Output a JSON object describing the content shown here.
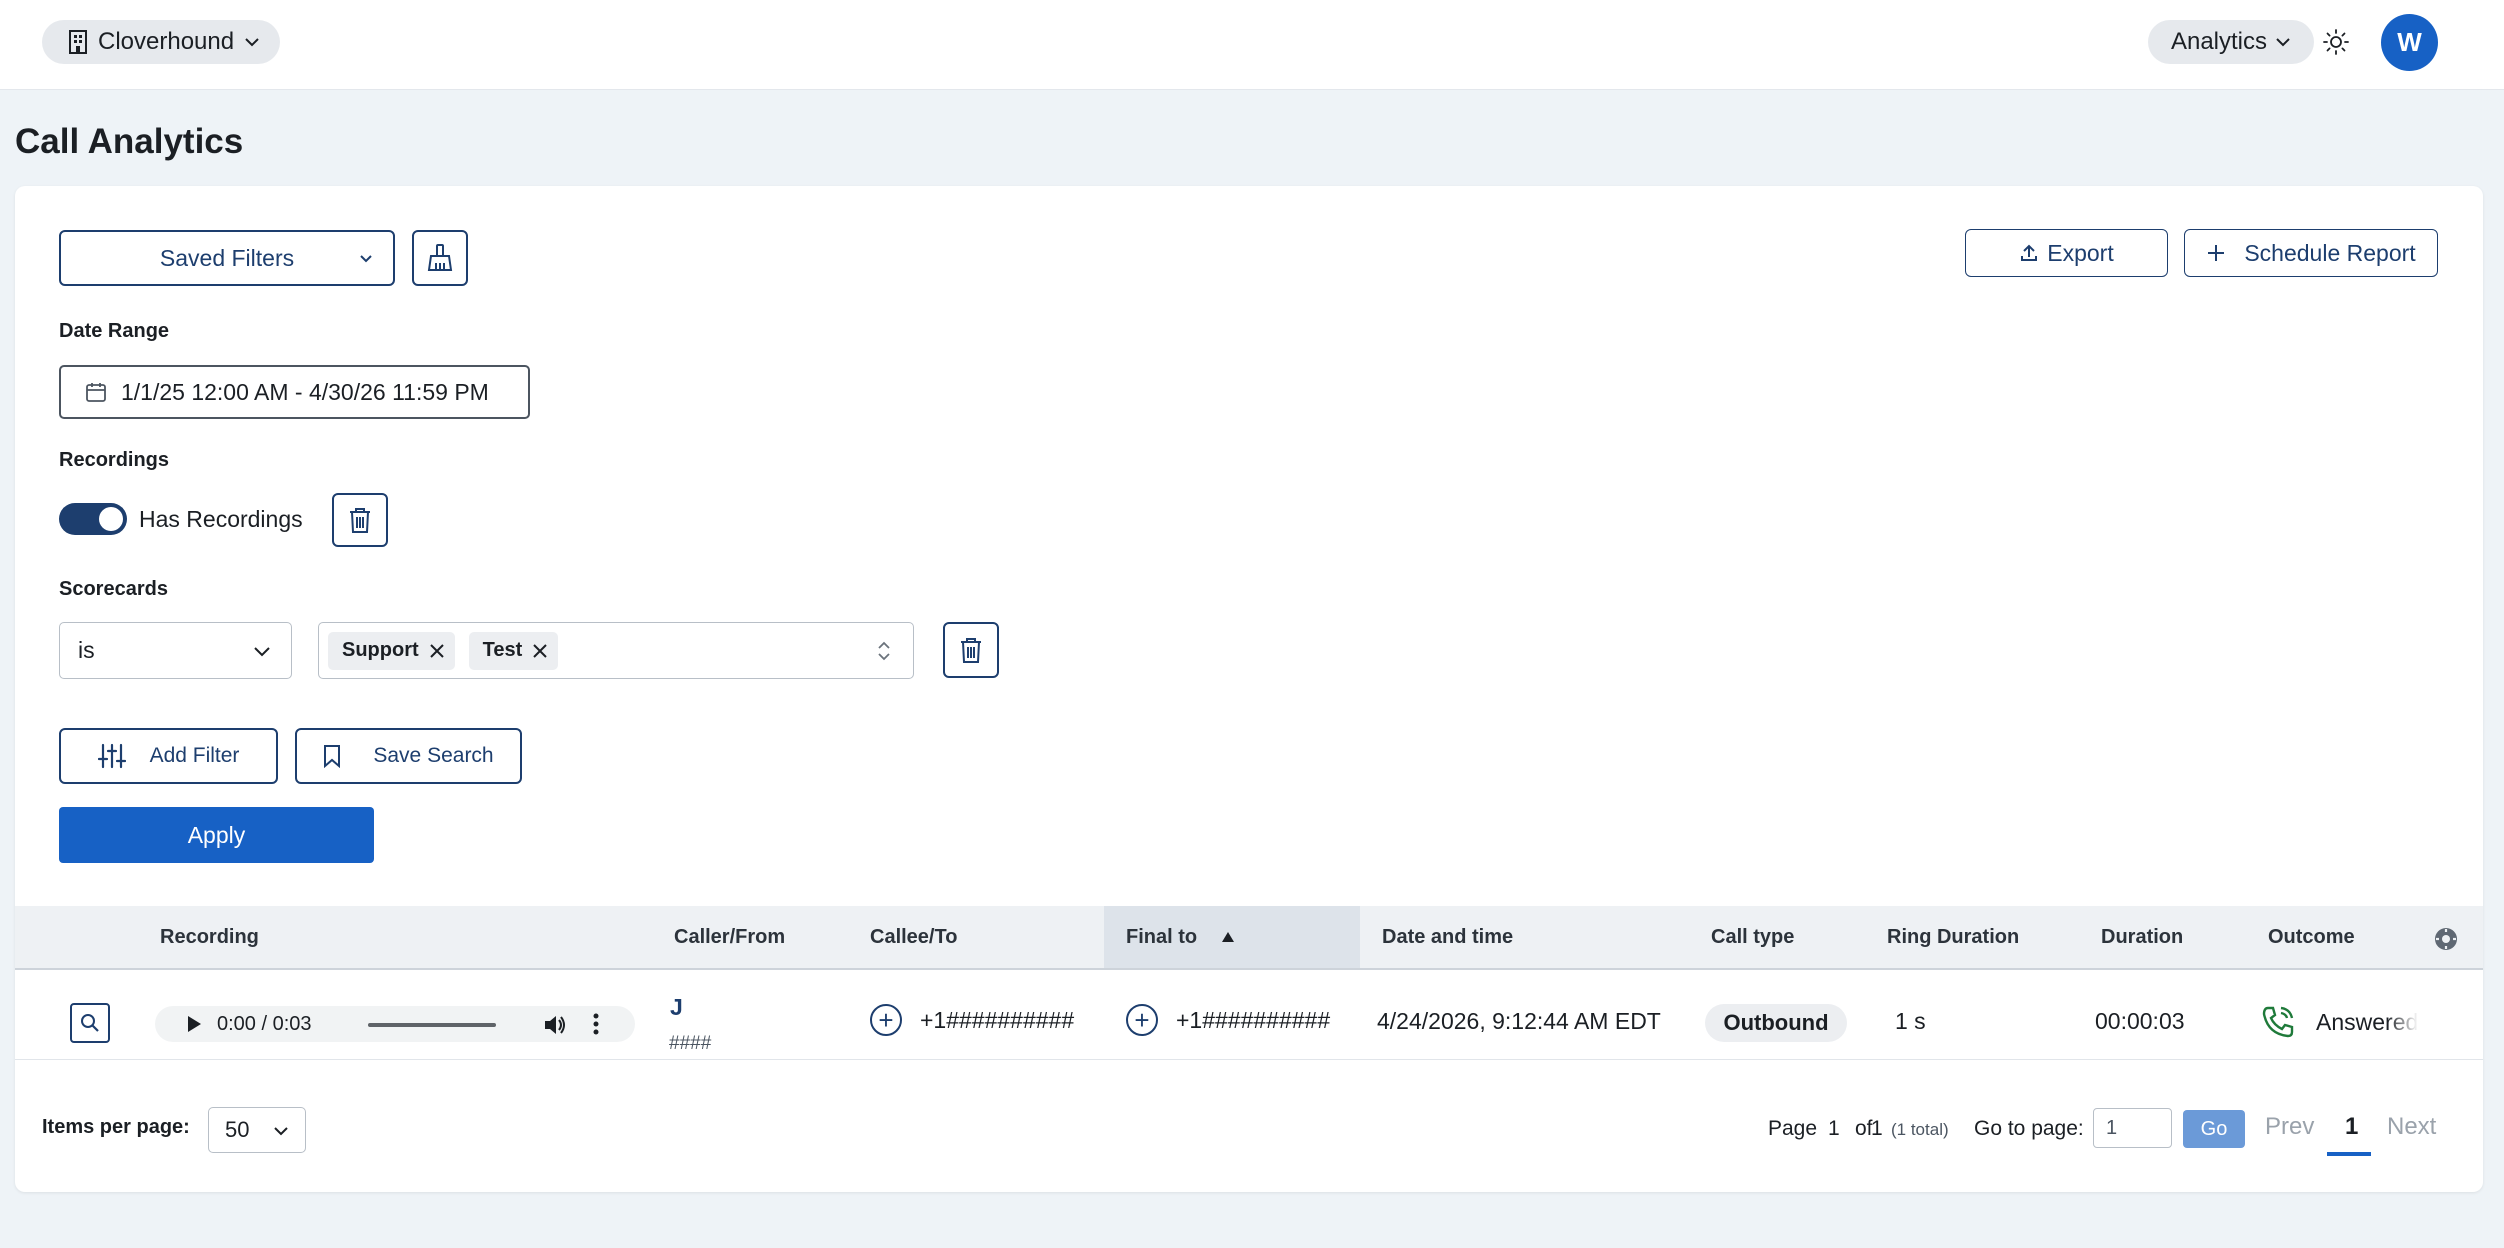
{
  "header": {
    "org_name": "Cloverhound",
    "analytics_label": "Analytics",
    "avatar_initial": "W"
  },
  "page": {
    "title": "Call Analytics"
  },
  "filters": {
    "saved_filters_label": "Saved Filters",
    "export_label": "Export",
    "schedule_report_label": "Schedule Report",
    "date_range_label": "Date Range",
    "date_range_value": "1/1/25 12:00 AM - 4/30/26 11:59 PM",
    "recordings_label": "Recordings",
    "has_recordings_label": "Has Recordings",
    "has_recordings_on": true,
    "scorecards_label": "Scorecards",
    "scorecards_operator": "is",
    "scorecards_chips": [
      "Support",
      "Test"
    ],
    "add_filter_label": "Add Filter",
    "save_search_label": "Save Search",
    "apply_label": "Apply"
  },
  "table": {
    "columns": [
      "Recording",
      "Caller/From",
      "Callee/To",
      "Final to",
      "Date and time",
      "Call type",
      "Ring Duration",
      "Duration",
      "Outcome"
    ],
    "sorted_column": "Final to",
    "rows": [
      {
        "player_time": "0:00 / 0:03",
        "caller_name": "J",
        "caller_number": "####",
        "callee": "+1##########",
        "final_to": "+1##########",
        "datetime": "4/24/2026, 9:12:44 AM EDT",
        "call_type": "Outbound",
        "ring_duration": "1 s",
        "duration": "00:00:03",
        "outcome": "Answered"
      }
    ]
  },
  "footer": {
    "items_per_page_label": "Items per page:",
    "items_per_page_value": "50",
    "page_label": "Page",
    "page_current": "1",
    "of_label": "of",
    "page_total": "1",
    "total_note": "(1 total)",
    "go_to_page_label": "Go to page:",
    "go_to_value": "1",
    "go_label": "Go",
    "prev_label": "Prev",
    "current_page_number": "1",
    "next_label": "Next"
  },
  "colors": {
    "primary": "#1761c5",
    "navy": "#1d3e6e",
    "answered_icon": "#1f7a3a"
  }
}
